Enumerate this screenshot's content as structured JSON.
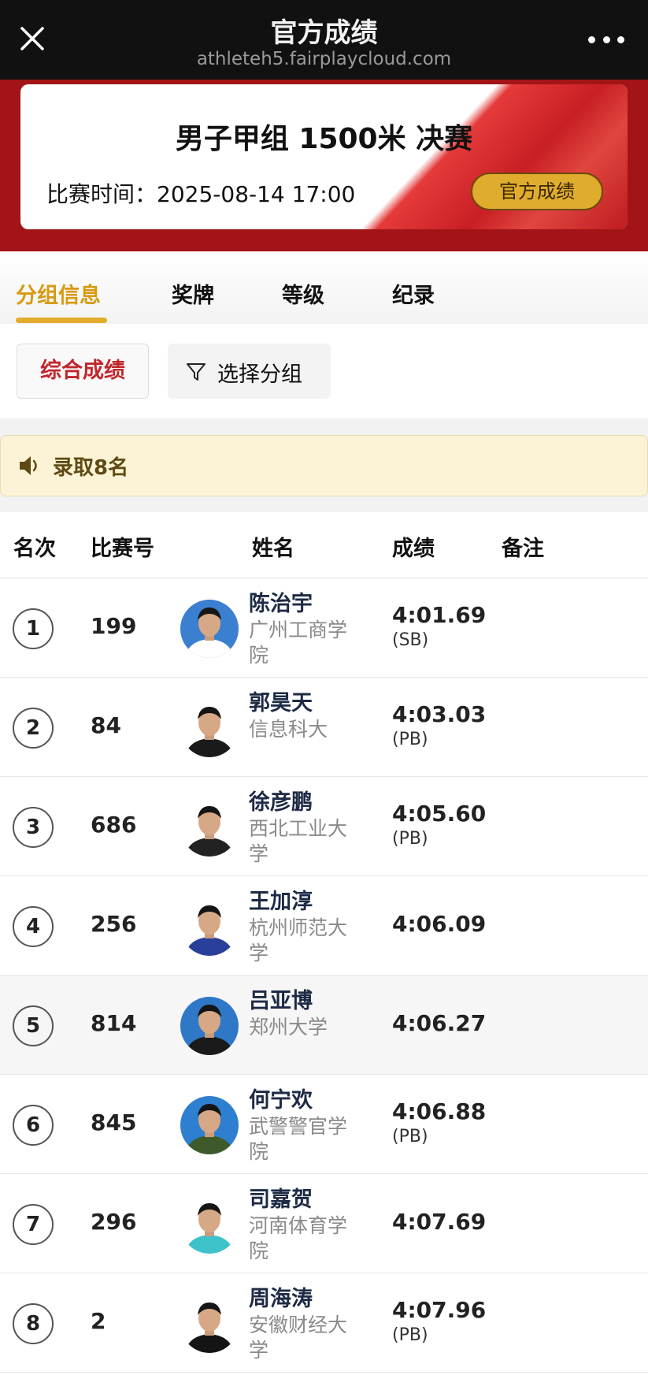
{
  "app": {
    "title": "官方成绩",
    "url": "athleteh5.fairplaycloud.com"
  },
  "event": {
    "name": "男子甲组 1500米 决赛",
    "time_label": "比赛时间：",
    "time_value": "2025-08-14  17:00",
    "badge": "官方成绩"
  },
  "tabs": [
    "分组信息",
    "奖牌",
    "等级",
    "纪录"
  ],
  "filters": {
    "overall": "综合成绩",
    "group": "选择分组"
  },
  "notice": "录取8名",
  "table": {
    "headers": [
      "名次",
      "比赛号",
      "姓名",
      "成绩",
      "备注"
    ],
    "rows": [
      {
        "rank": "1",
        "bib": "199",
        "name": "陈治宇",
        "school": "广州工商学院",
        "mark": "4:01.69",
        "note": "(SB)",
        "shirt": "#ffffff",
        "bg": "#3a7fd0"
      },
      {
        "rank": "2",
        "bib": "84",
        "name": "郭昊天",
        "school": "信息科大",
        "mark": "4:03.03",
        "note": "(PB)",
        "shirt": "#1a1a1a",
        "bg": "#ffffff"
      },
      {
        "rank": "3",
        "bib": "686",
        "name": "徐彦鹏",
        "school": "西北工业大学",
        "mark": "4:05.60",
        "note": "(PB)",
        "shirt": "#222222",
        "bg": "#ffffff"
      },
      {
        "rank": "4",
        "bib": "256",
        "name": "王加淳",
        "school": "杭州师范大学",
        "mark": "4:06.09",
        "note": "",
        "shirt": "#2a3f9a",
        "bg": "#ffffff"
      },
      {
        "rank": "5",
        "bib": "814",
        "name": "吕亚博",
        "school": "郑州大学",
        "mark": "4:06.27",
        "note": "",
        "shirt": "#1a1a1a",
        "bg": "#2f78c8"
      },
      {
        "rank": "6",
        "bib": "845",
        "name": "何宁欢",
        "school": "武警警官学院",
        "mark": "4:06.88",
        "note": "(PB)",
        "shirt": "#3f5a2a",
        "bg": "#2f7fd0"
      },
      {
        "rank": "7",
        "bib": "296",
        "name": "司嘉贺",
        "school": "河南体育学院",
        "mark": "4:07.69",
        "note": "",
        "shirt": "#3ec2c9",
        "bg": "#ffffff"
      },
      {
        "rank": "8",
        "bib": "2",
        "name": "周海涛",
        "school": "安徽财经大学",
        "mark": "4:07.96",
        "note": "(PB)",
        "shirt": "#141414",
        "bg": "#ffffff"
      }
    ]
  }
}
